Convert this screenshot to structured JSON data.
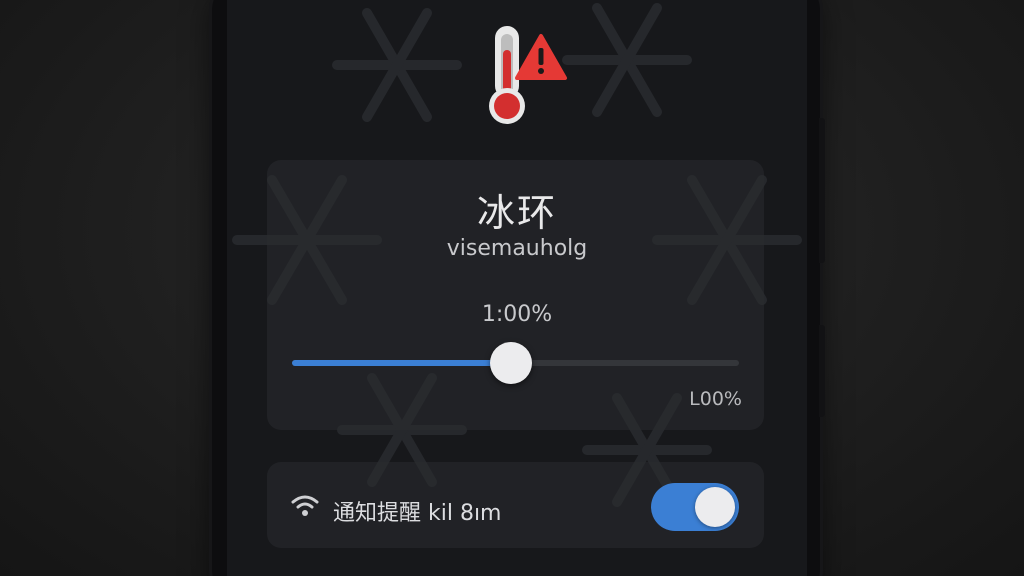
{
  "header": {
    "icon": "thermometer-warning-icon"
  },
  "card": {
    "title": "冰环",
    "subtitle": "visemauholg",
    "value_label": "1:00%",
    "max_label": "L00%"
  },
  "slider": {
    "level_fraction": 0.49
  },
  "notification": {
    "icon": "wifi-icon",
    "label": "通知提醒 kil 8ım",
    "toggle_on": true
  },
  "colors": {
    "accent": "#3b7fd4",
    "thermometer_red": "#d32f2f",
    "warning_red": "#e53935"
  }
}
